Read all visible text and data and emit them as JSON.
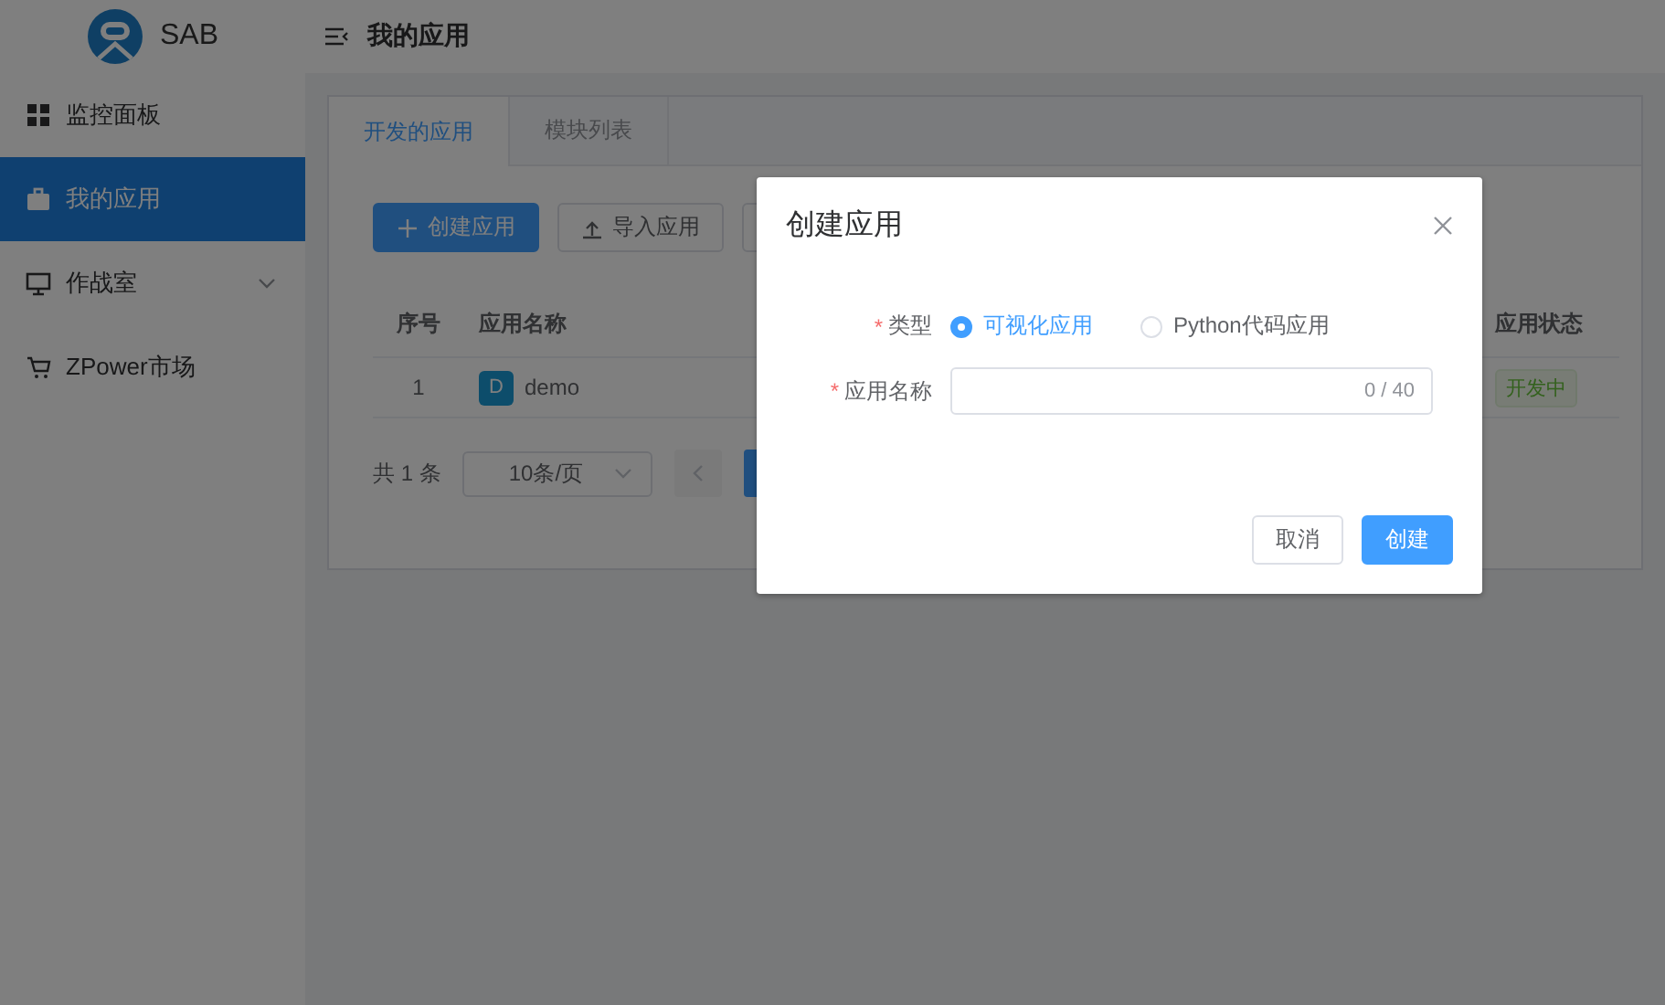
{
  "sidebar": {
    "logo": "SAB",
    "items": [
      {
        "label": "监控面板",
        "selected": false,
        "expandable": false
      },
      {
        "label": "我的应用",
        "selected": true,
        "expandable": false
      },
      {
        "label": "作战室",
        "selected": false,
        "expandable": true
      },
      {
        "label": "ZPower市场",
        "selected": false,
        "expandable": false
      }
    ]
  },
  "header": {
    "title": "我的应用"
  },
  "tabs": [
    {
      "label": "开发的应用",
      "selected": true
    },
    {
      "label": "模块列表",
      "selected": false
    }
  ],
  "toolbar": [
    {
      "label": "创建应用",
      "kind": "primary"
    },
    {
      "label": "导入应用",
      "kind": "upload"
    },
    {
      "kind": "plain"
    }
  ],
  "table": {
    "columns": [
      {
        "label": "序号"
      },
      {
        "label": "应用名称"
      },
      {
        "label": "应用状态"
      }
    ],
    "rows": [
      {
        "index": "1",
        "avatar": "D",
        "name": "demo",
        "status": "开发中"
      }
    ]
  },
  "pagination": {
    "total": "共 1 条",
    "page_size": "10条/页",
    "pages": [
      {
        "selected": true
      }
    ]
  },
  "dialog": {
    "title": "创建应用",
    "fields": [
      {
        "kind": "radio",
        "required_mark": "*",
        "label": "类型",
        "options": [
          {
            "label": "可视化应用",
            "selected": true
          },
          {
            "label": "Python代码应用",
            "selected": false
          }
        ]
      },
      {
        "kind": "text",
        "required_mark": "*",
        "label": "应用名称",
        "counter": "0 / 40"
      }
    ],
    "buttons": [
      {
        "label": "取消",
        "kind": "default"
      },
      {
        "label": "创建",
        "kind": "primary"
      }
    ]
  }
}
